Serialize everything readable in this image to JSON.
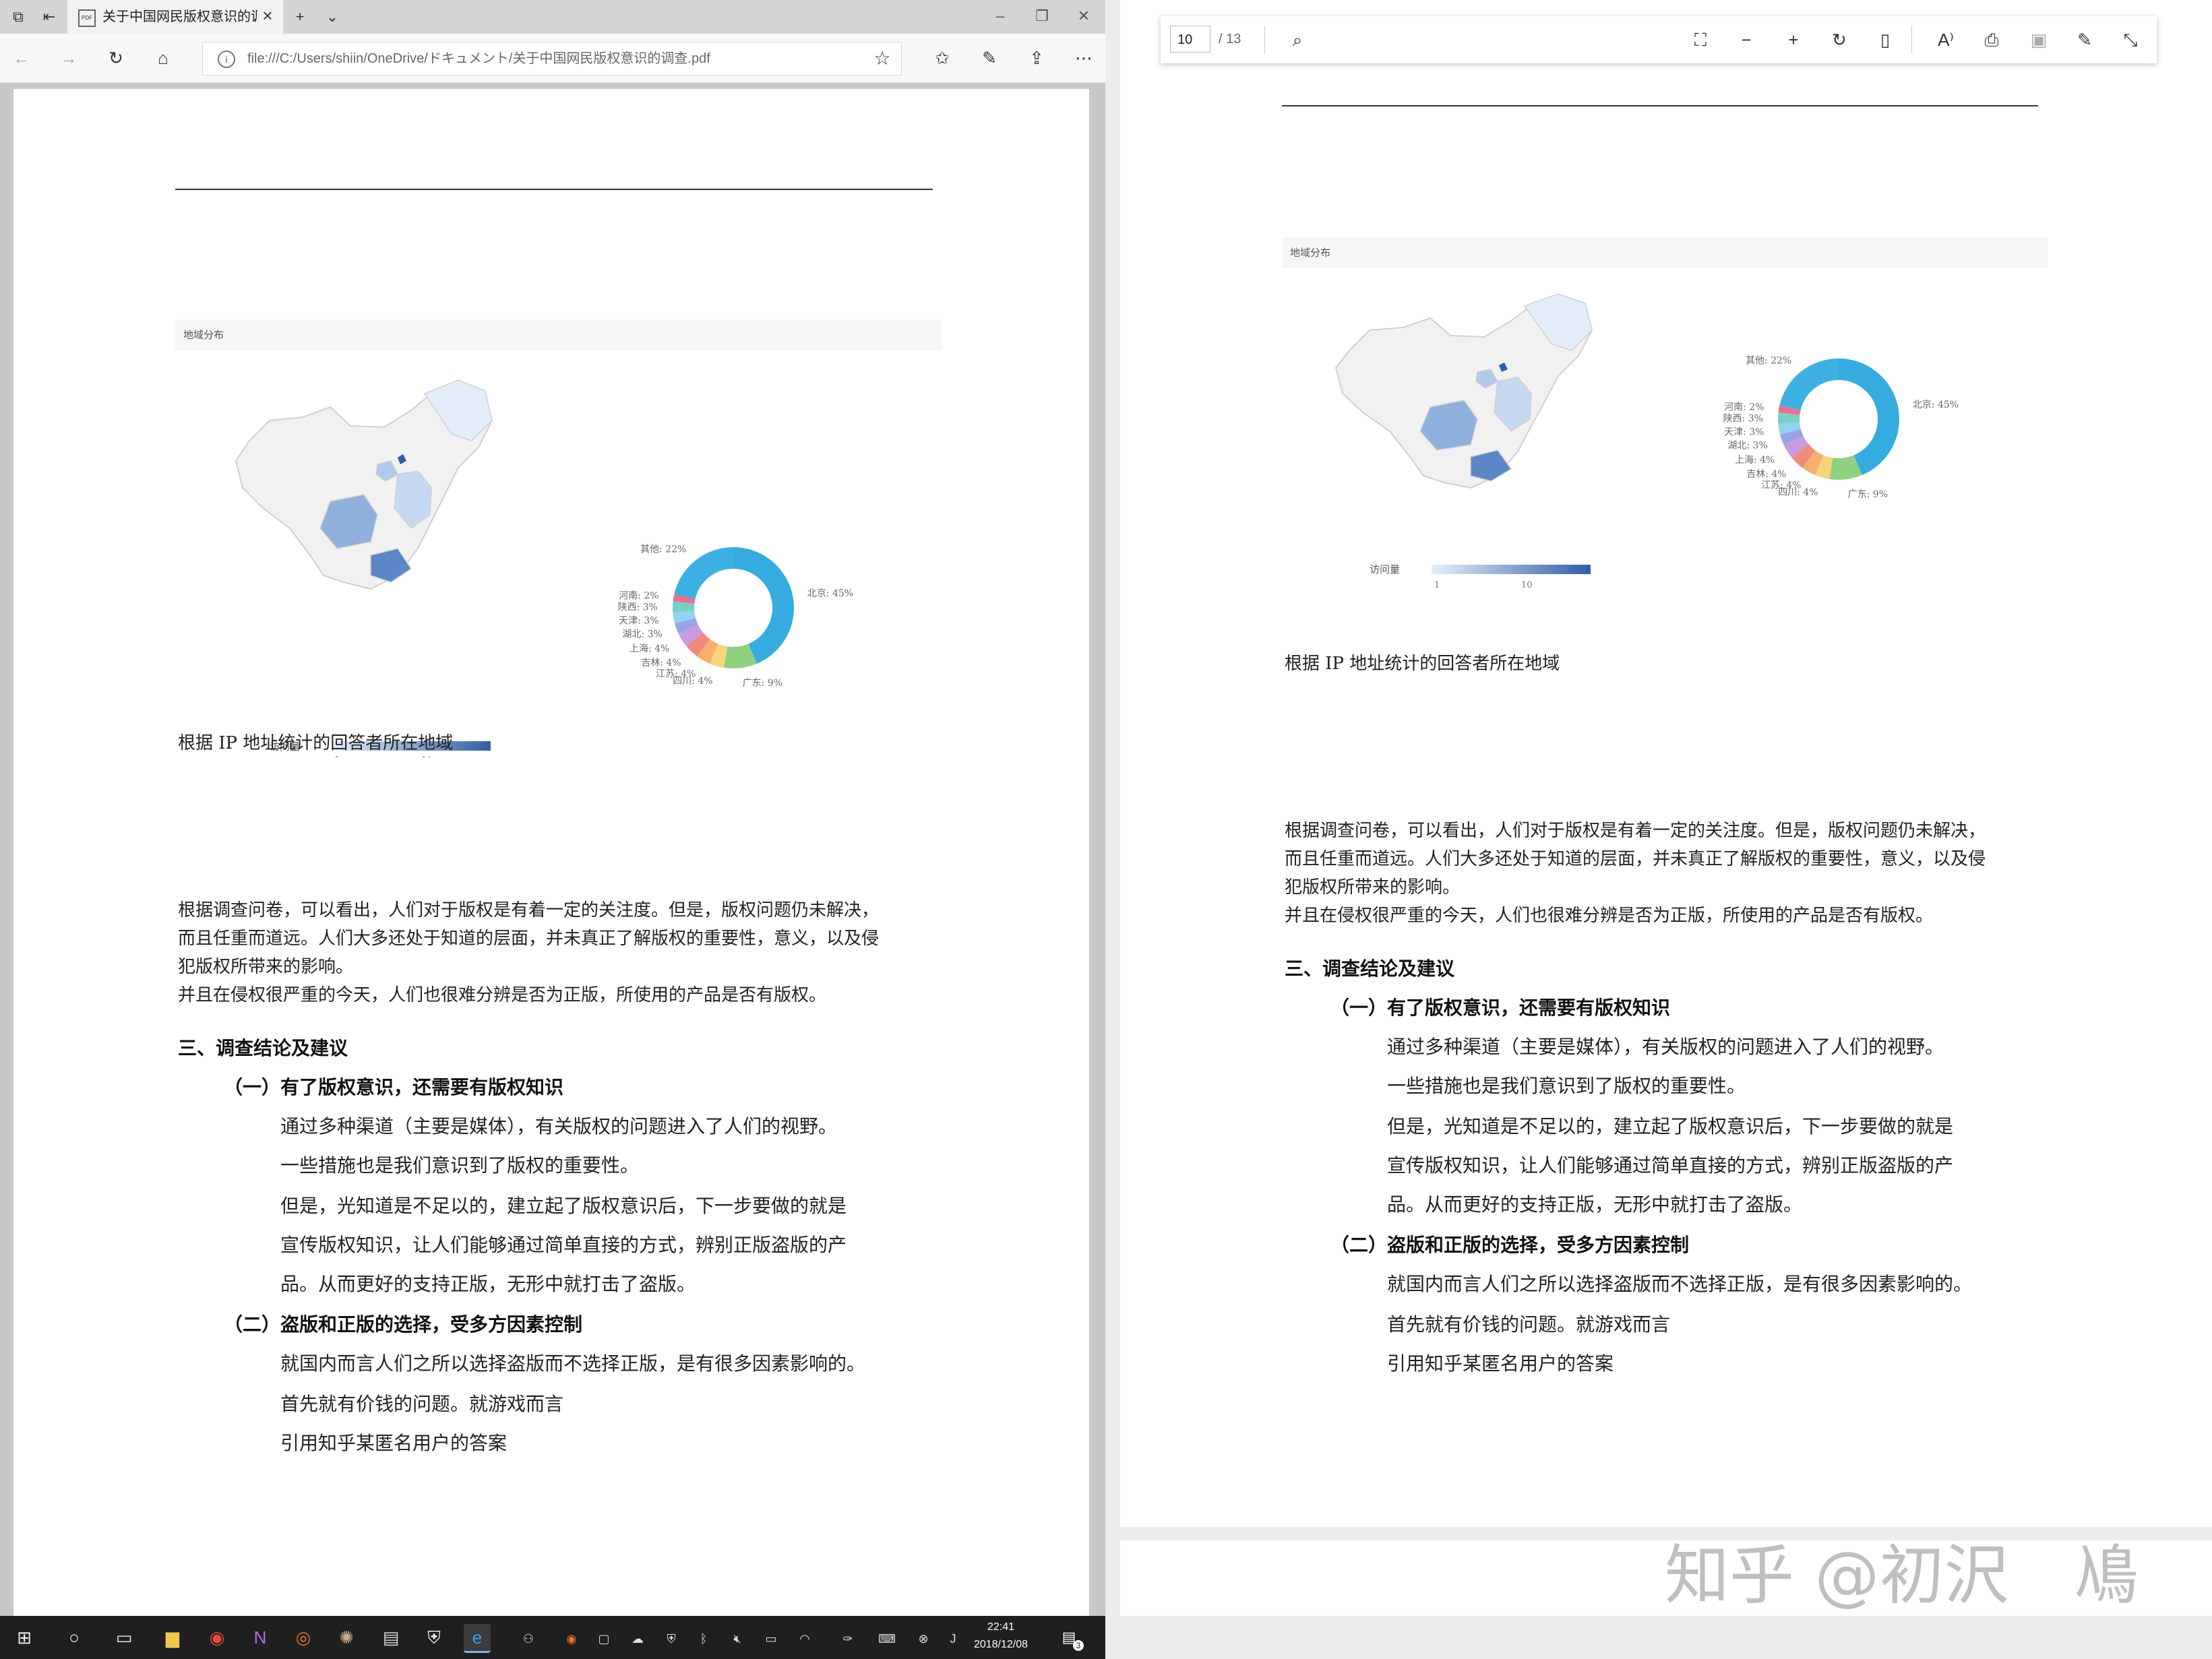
{
  "browser": {
    "tab_title": "关于中国网民版权意识的调查.pdf",
    "pdf_badge": "PDF",
    "address_url": "file:///C:/Users/shiin/OneDrive/ドキュメント/关于中国网民版权意识的调查.pdf"
  },
  "document": {
    "chart_header": "地域分布",
    "chart_caption": "根据 IP 地址统计的回答者所在地域",
    "paragraph_lines": [
      "根据调查问卷，可以看出，人们对于版权是有着一定的关注度。但是，版权问题仍未解决，",
      "而且任重而道远。人们大多还处于知道的层面，并未真正了解版权的重要性，意义，以及侵",
      "犯版权所带来的影响。",
      "并且在侵权很严重的今天，人们也很难分辨是否为正版，所使用的产品是否有版权。"
    ],
    "section_heading": "三、调查结论及建议",
    "sub1_heading": "（一）有了版权意识，还需要有版权知识",
    "sub1_lines": [
      "通过多种渠道（主要是媒体），有关版权的问题进入了人们的视野。",
      "一些措施也是我们意识到了版权的重要性。",
      "但是，光知道是不足以的，建立起了版权意识后，下一步要做的就是",
      "宣传版权知识，让人们能够通过简单直接的方式，辨别正版盗版的产",
      "品。从而更好的支持正版，无形中就打击了盗版。"
    ],
    "sub2_heading": "（二）盗版和正版的选择，受多方因素控制",
    "sub2_lines": [
      "就国内而言人们之所以选择盗版而不选择正版，是有很多因素影响的。",
      "首先就有价钱的问题。就游戏而言",
      "引用知乎某匿名用户的答案"
    ]
  },
  "chart_data": {
    "type": "pie",
    "title": "地域分布",
    "categories": [
      "北京",
      "广东",
      "四川",
      "江苏",
      "吉林",
      "上海",
      "湖北",
      "天津",
      "陕西",
      "河南",
      "其他"
    ],
    "values": [
      45,
      9,
      4,
      4,
      4,
      4,
      3,
      3,
      3,
      2,
      22
    ],
    "unit": "%",
    "colors": [
      "#35ace0",
      "#8ed27f",
      "#f8d578",
      "#f7b06b",
      "#f08a7c",
      "#c69be0",
      "#9aa2e8",
      "#92d3ef",
      "#76d0c8",
      "#f06d8a",
      "#3db0e3"
    ],
    "map_legend": {
      "label": "访问量",
      "ticks": [
        "1",
        "10"
      ]
    }
  },
  "taskbar": {
    "time": "22:41",
    "date": "2018/12/08",
    "notification_count": "3"
  },
  "pdf_viewer": {
    "page_number": "10",
    "page_total": "/ 13"
  },
  "watermark": "知乎 @初沢　鳰"
}
